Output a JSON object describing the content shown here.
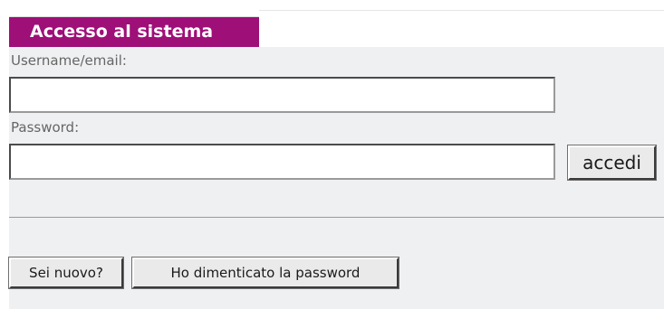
{
  "login_panel": {
    "title": "Accesso al sistema",
    "username_label": "Username/email:",
    "username_value": "",
    "password_label": "Password:",
    "password_value": "",
    "submit_label": "accedi",
    "new_user_label": "Sei nuovo?",
    "forgot_password_label": "Ho dimenticato la password"
  },
  "colors": {
    "title_background": "#9e0f78",
    "title_text": "#ffffff",
    "panel_background": "#eff0f2",
    "label_text": "#666666"
  }
}
